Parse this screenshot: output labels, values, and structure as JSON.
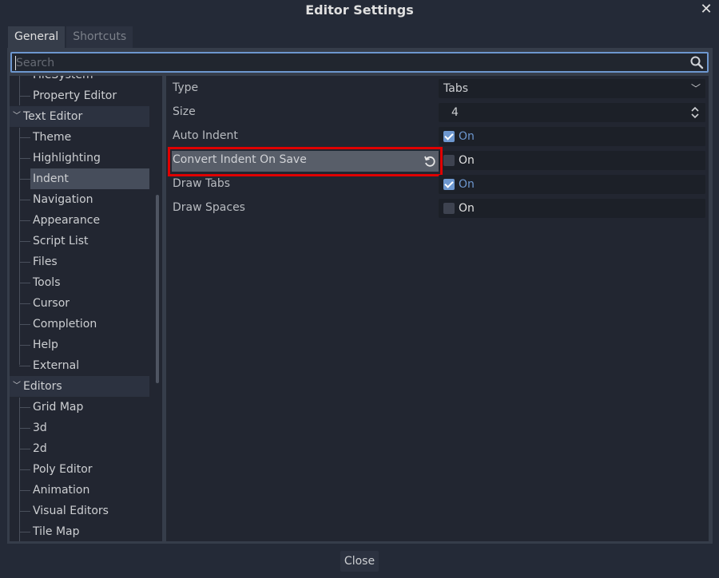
{
  "window": {
    "title": "Editor Settings"
  },
  "tabs": [
    {
      "label": "General"
    },
    {
      "label": "Shortcuts"
    }
  ],
  "search": {
    "placeholder": "Search",
    "value": ""
  },
  "tree": {
    "items": [
      {
        "label": "FileSystem",
        "kind": "child"
      },
      {
        "label": "Property Editor",
        "kind": "child"
      },
      {
        "label": "Text Editor",
        "kind": "category"
      },
      {
        "label": "Theme",
        "kind": "child"
      },
      {
        "label": "Highlighting",
        "kind": "child"
      },
      {
        "label": "Indent",
        "kind": "child",
        "selected": true
      },
      {
        "label": "Navigation",
        "kind": "child"
      },
      {
        "label": "Appearance",
        "kind": "child"
      },
      {
        "label": "Script List",
        "kind": "child"
      },
      {
        "label": "Files",
        "kind": "child"
      },
      {
        "label": "Tools",
        "kind": "child"
      },
      {
        "label": "Cursor",
        "kind": "child"
      },
      {
        "label": "Completion",
        "kind": "child"
      },
      {
        "label": "Help",
        "kind": "child"
      },
      {
        "label": "External",
        "kind": "child"
      },
      {
        "label": "Editors",
        "kind": "category"
      },
      {
        "label": "Grid Map",
        "kind": "child"
      },
      {
        "label": "3d",
        "kind": "child"
      },
      {
        "label": "2d",
        "kind": "child"
      },
      {
        "label": "Poly Editor",
        "kind": "child"
      },
      {
        "label": "Animation",
        "kind": "child"
      },
      {
        "label": "Visual Editors",
        "kind": "child"
      },
      {
        "label": "Tile Map",
        "kind": "child"
      }
    ]
  },
  "properties": [
    {
      "label": "Type",
      "value": "Tabs",
      "kind": "dropdown"
    },
    {
      "label": "Size",
      "value": "4",
      "kind": "spin"
    },
    {
      "label": "Auto Indent",
      "value": "On",
      "kind": "check",
      "checked": true
    },
    {
      "label": "Convert Indent On Save",
      "value": "On",
      "kind": "check",
      "checked": false,
      "highlighted": true
    },
    {
      "label": "Draw Tabs",
      "value": "On",
      "kind": "check",
      "checked": true
    },
    {
      "label": "Draw Spaces",
      "value": "On",
      "kind": "check",
      "checked": false
    }
  ],
  "footer": {
    "close_label": "Close"
  },
  "colors": {
    "accent": "#6d97cf",
    "highlight": "#e00000"
  }
}
